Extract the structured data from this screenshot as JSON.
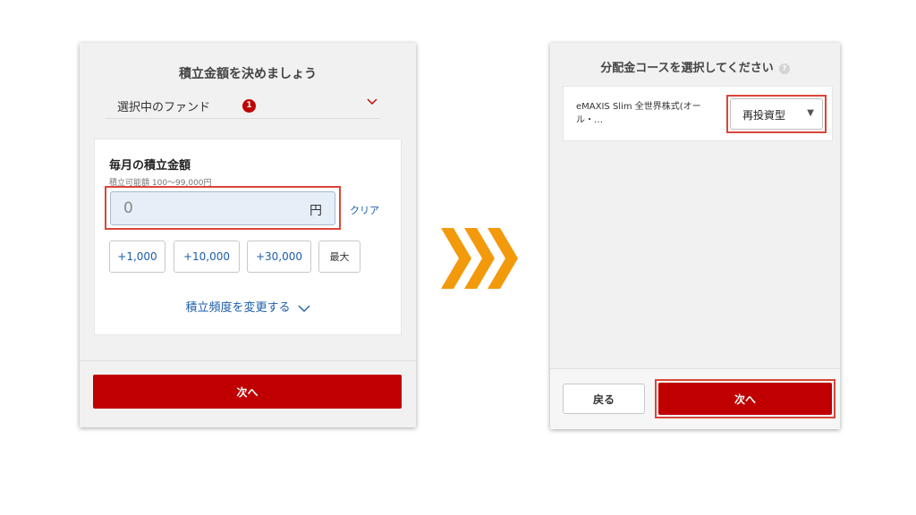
{
  "left_panel": {
    "title": "積立金額を決めましょう",
    "fund_selector": {
      "label": "選択中のファンド",
      "count": "1"
    },
    "monthly_amount": {
      "title": "毎月の積立金額",
      "range_note": "積立可能額 100〜99,000円",
      "value": "0",
      "unit": "円",
      "clear_label": "クリア"
    },
    "quick_buttons": [
      "+1,000",
      "+10,000",
      "+30,000",
      "最大"
    ],
    "frequency_link": "積立頻度を変更する",
    "next_label": "次へ"
  },
  "right_panel": {
    "title": "分配金コースを選択してください",
    "help_icon_text": "?",
    "fund_name": "eMAXIS Slim 全世界株式(オール・…",
    "course_select": {
      "selected": "再投資型",
      "caret": "▼"
    },
    "back_label": "戻る",
    "next_label": "次へ"
  },
  "colors": {
    "primary_red": "#c00000",
    "highlight_outline": "#d9463a",
    "link_blue": "#1a5ea8",
    "arrow_orange": "#f29a0c"
  },
  "icons": [
    "chevron-down-icon",
    "triple-chevron-right-arrow-icon",
    "help-icon"
  ]
}
